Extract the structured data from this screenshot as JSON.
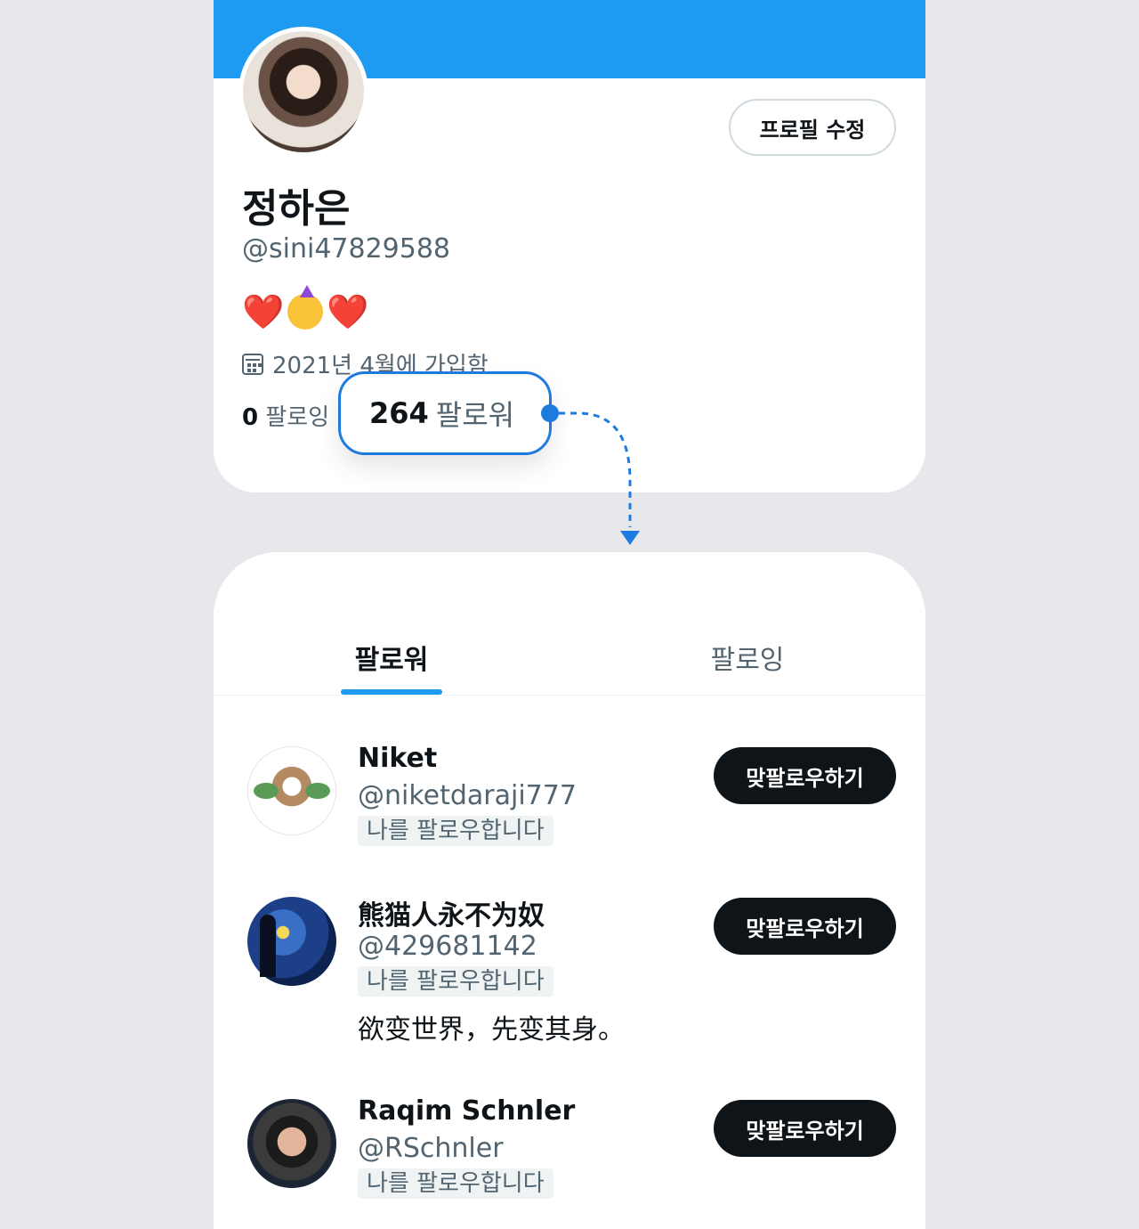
{
  "profile": {
    "edit_button": "프로필 수정",
    "display_name": "정하은",
    "handle": "@sini47829588",
    "bio": [
      "❤️",
      "🥳",
      "❤️"
    ],
    "joined": "2021년 4월에 가입함",
    "following_count": "0",
    "following_label": "팔로잉",
    "followers_count": "264",
    "followers_label": "팔로워"
  },
  "tabs": {
    "followers": "팔로워",
    "following": "팔로잉",
    "active": "followers"
  },
  "followers": [
    {
      "name": "Niket",
      "handle": "@niketdaraji777",
      "badge": "나를 팔로우합니다",
      "bio": "",
      "button": "맞팔로우하기"
    },
    {
      "name": "熊猫人永不为奴",
      "handle": "@429681142",
      "badge": "나를 팔로우합니다",
      "bio": "欲变世界，先变其身。",
      "button": "맞팔로우하기"
    },
    {
      "name": "Raqim Schnler",
      "handle": "@RSchnler",
      "badge": "나를 팔로우합니다",
      "bio": "",
      "button": "맞팔로우하기"
    }
  ],
  "colors": {
    "accent": "#1d9bf0",
    "highlight_border": "#1f7ae0",
    "text_primary": "#0f1419",
    "text_secondary": "#536471",
    "background": "#e6e8ec"
  }
}
